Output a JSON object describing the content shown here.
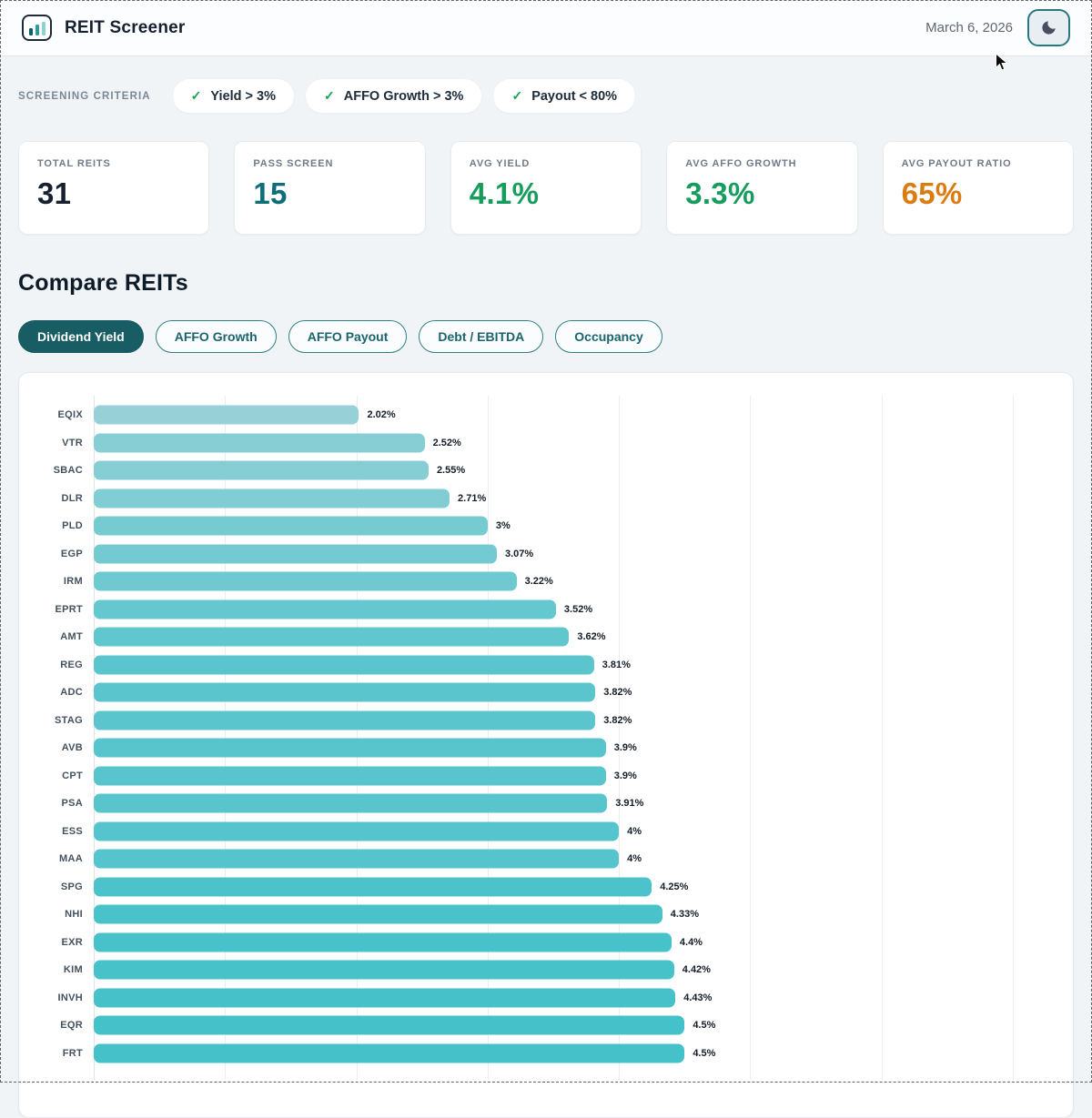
{
  "header": {
    "title": "REIT Screener",
    "date": "March 6, 2026",
    "brand_icon": "bar-chart-icon",
    "theme_toggle_icon": "moon-icon"
  },
  "criteria": {
    "label": "SCREENING CRITERIA",
    "check_glyph": "✓",
    "chips": [
      "Yield > 3%",
      "AFFO Growth > 3%",
      "Payout < 80%"
    ]
  },
  "stats": [
    {
      "label": "TOTAL REITS",
      "value": "31",
      "color": "#16202e"
    },
    {
      "label": "PASS SCREEN",
      "value": "15",
      "color": "#0d6e79"
    },
    {
      "label": "AVG YIELD",
      "value": "4.1%",
      "color": "#169d5e"
    },
    {
      "label": "AVG AFFO GROWTH",
      "value": "3.3%",
      "color": "#169d5e"
    },
    {
      "label": "AVG PAYOUT RATIO",
      "value": "65%",
      "color": "#da7c10"
    }
  ],
  "compare": {
    "title": "Compare REITs",
    "tabs": [
      {
        "label": "Dividend Yield",
        "active": true
      },
      {
        "label": "AFFO Growth",
        "active": false
      },
      {
        "label": "AFFO Payout",
        "active": false
      },
      {
        "label": "Debt / EBITDA",
        "active": false
      },
      {
        "label": "Occupancy",
        "active": false
      }
    ]
  },
  "chart_data": {
    "type": "bar",
    "orientation": "horizontal",
    "metric": "Dividend Yield",
    "categories": [
      "EQIX",
      "VTR",
      "SBAC",
      "DLR",
      "PLD",
      "EGP",
      "IRM",
      "EPRT",
      "AMT",
      "REG",
      "ADC",
      "STAG",
      "AVB",
      "CPT",
      "PSA",
      "ESS",
      "MAA",
      "SPG",
      "NHI",
      "EXR",
      "KIM",
      "INVH",
      "EQR",
      "FRT"
    ],
    "values": [
      2.02,
      2.52,
      2.55,
      2.71,
      3,
      3.07,
      3.22,
      3.52,
      3.62,
      3.81,
      3.82,
      3.82,
      3.9,
      3.9,
      3.91,
      4,
      4,
      4.25,
      4.33,
      4.4,
      4.42,
      4.43,
      4.5,
      4.5
    ],
    "value_labels": [
      "2.02%",
      "2.52%",
      "2.55%",
      "2.71%",
      "3%",
      "3.07%",
      "3.22%",
      "3.52%",
      "3.62%",
      "3.81%",
      "3.82%",
      "3.82%",
      "3.9%",
      "3.9%",
      "3.91%",
      "4%",
      "4%",
      "4.25%",
      "4.33%",
      "4.4%",
      "4.42%",
      "4.43%",
      "4.5%",
      "4.5%"
    ],
    "x_max": 7.36,
    "gridline_values": [
      1,
      2,
      3,
      4,
      5,
      6,
      7
    ],
    "grid": true,
    "legend": false,
    "bar_color_low": "#97d1d7",
    "bar_color_high": "#44c1c9",
    "color_value_domain": [
      2.02,
      4.5
    ]
  }
}
